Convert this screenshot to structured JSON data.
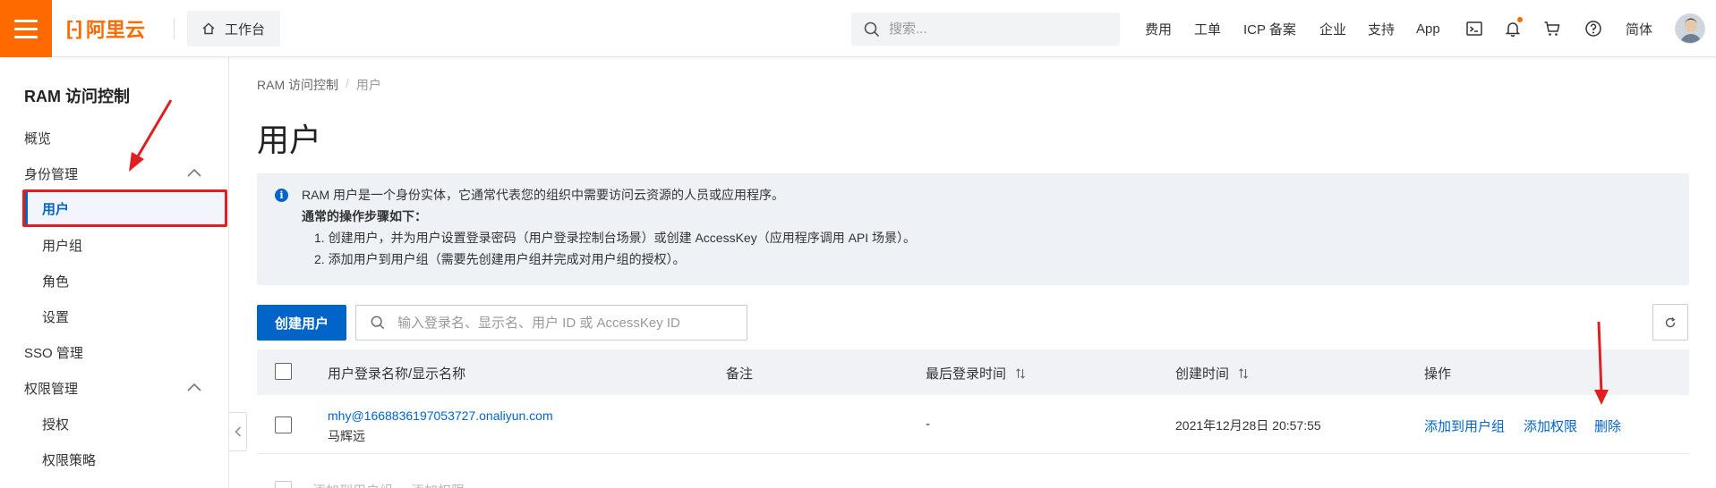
{
  "header": {
    "logo_text": "阿里云",
    "logo_mark": "[-]",
    "workbench_label": "工作台",
    "search_placeholder": "搜索...",
    "nav": [
      "费用",
      "工单",
      "ICP 备案",
      "企业",
      "支持",
      "App"
    ],
    "lang_label": "简体",
    "brand_color": "#ff6a00"
  },
  "sidebar": {
    "title": "RAM 访问控制",
    "overview": "概览",
    "identity_group": "身份管理",
    "identity_items": [
      "用户",
      "用户组",
      "角色",
      "设置"
    ],
    "sso": "SSO 管理",
    "permission_group": "权限管理",
    "permission_items": [
      "授权",
      "权限策略"
    ],
    "active_item": "用户",
    "accent_color": "#0064c8"
  },
  "main": {
    "breadcrumb": [
      "RAM 访问控制",
      "用户"
    ],
    "breadcrumb_sep": "/",
    "title": "用户",
    "info": {
      "intro": "RAM 用户是一个身份实体，它通常代表您的组织中需要访问云资源的人员或应用程序。",
      "steps_title": "通常的操作步骤如下：",
      "steps": [
        "1. 创建用户，并为用户设置登录密码（用户登录控制台场景）或创建 AccessKey（应用程序调用 API 场景）。",
        "2. 添加用户到用户组（需要先创建用户组并完成对用户组的授权）。"
      ]
    },
    "create_button": "创建用户",
    "search_placeholder": "输入登录名、显示名、用户 ID 或 AccessKey ID",
    "table": {
      "columns": [
        "用户登录名称/显示名称",
        "备注",
        "最后登录时间",
        "创建时间",
        "操作"
      ],
      "rows": [
        {
          "login_name": "mhy@1668836197053727.onaliyun.com",
          "display_name": "马辉远",
          "remark": "",
          "last_login": "-",
          "created": "2021年12月28日 20:57:55",
          "actions": [
            "添加到用户组",
            "添加权限",
            "删除"
          ]
        }
      ],
      "bulk_actions": [
        "添加到用户组",
        "添加权限"
      ]
    }
  }
}
